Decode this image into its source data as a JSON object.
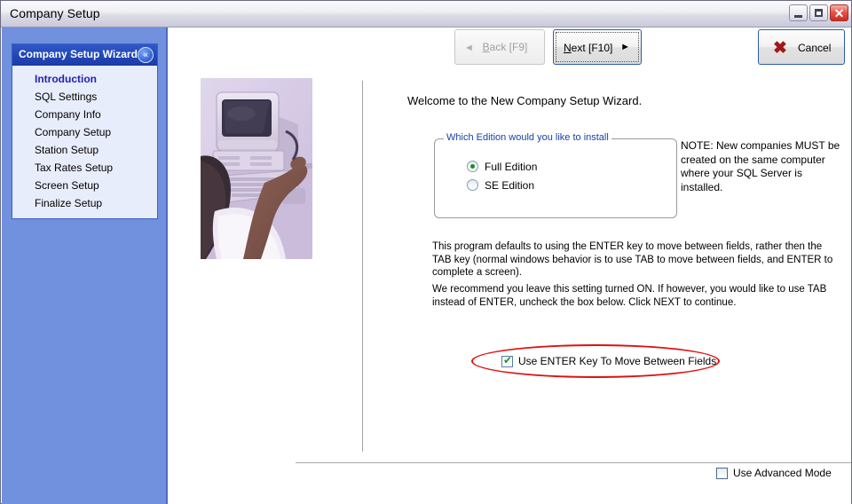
{
  "window": {
    "title": "Company Setup",
    "controls": {
      "minimize": "minimize",
      "maximize": "maximize",
      "close_glyph": "✕"
    }
  },
  "sidebar": {
    "panel_title": "Company Setup Wizard",
    "collapse_glyph": "«",
    "items": [
      {
        "label": "Introduction",
        "active": true
      },
      {
        "label": "SQL Settings",
        "active": false
      },
      {
        "label": "Company Info",
        "active": false
      },
      {
        "label": "Company Setup",
        "active": false
      },
      {
        "label": "Station Setup",
        "active": false
      },
      {
        "label": "Tax Rates Setup",
        "active": false
      },
      {
        "label": "Screen Setup",
        "active": false
      },
      {
        "label": "Finalize Setup",
        "active": false
      }
    ]
  },
  "toolbar": {
    "back": {
      "label_underlined": "B",
      "label_rest": "ack [F9]",
      "arrow": "◄",
      "disabled": true
    },
    "next": {
      "label_underlined": "N",
      "label_rest": "ext [F10]",
      "arrow": "►",
      "focused": true
    },
    "cancel": {
      "label": "Cancel",
      "icon_glyph": "✖"
    }
  },
  "main": {
    "welcome": "Welcome to the New Company Setup Wizard.",
    "groupbox": {
      "legend": "Which Edition would you like to install",
      "options": [
        {
          "label": "Full Edition",
          "selected": true
        },
        {
          "label": "SE Edition",
          "selected": false
        }
      ]
    },
    "note": "NOTE: New companies MUST be created on the same computer where your SQL Server is installed.",
    "paragraph1": "This program defaults to using the ENTER key to move between fields, rather then the TAB key (normal windows behavior is to use TAB to move between fields, and ENTER to complete a screen).",
    "paragraph2": "We recommend you leave this setting turned ON.  If however, you would like to use TAB instead of ENTER, uncheck the box below.  Click NEXT to continue.",
    "enter_checkbox": {
      "label": "Use ENTER Key To Move Between Fields",
      "checked": true,
      "tick_glyph": "✔",
      "highlight_color": "#dd1111"
    },
    "advanced_checkbox": {
      "label": "Use Advanced Mode",
      "checked": false
    }
  },
  "colors": {
    "sidebar_bg": "#7190dd",
    "panel_header": "#2348b8",
    "active_item": "#2222bb",
    "legend_text": "#1a3ea8",
    "accent_green": "#179017",
    "cancel_red": "#a01818"
  }
}
